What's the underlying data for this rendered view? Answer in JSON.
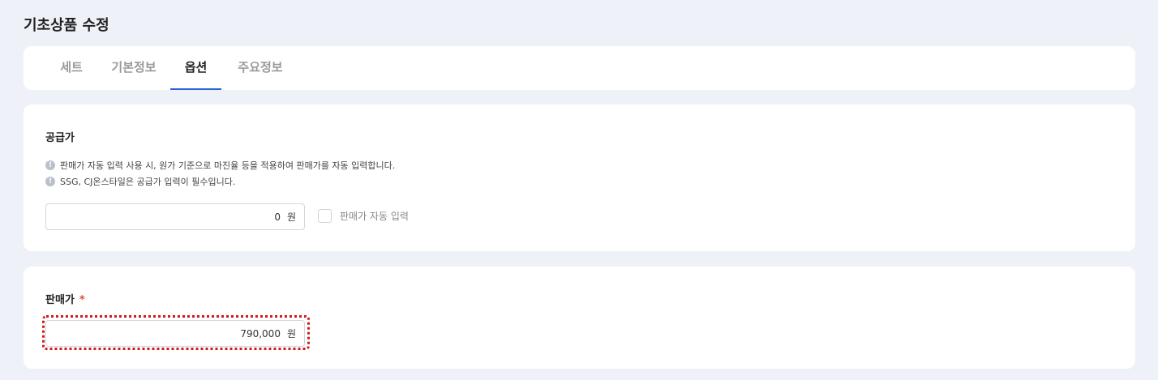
{
  "page": {
    "title": "기초상품 수정"
  },
  "tabs": [
    {
      "label": "세트",
      "active": false
    },
    {
      "label": "기본정보",
      "active": false
    },
    {
      "label": "옵션",
      "active": true
    },
    {
      "label": "주요정보",
      "active": false
    }
  ],
  "supply": {
    "label": "공급가",
    "notices": [
      "판매가 자동 입력 사용 시, 원가 기준으로 마진율 등을 적용하여 판매가를 자동 입력합니다.",
      "SSG, CJ온스타일은 공급가 입력이 필수입니다."
    ],
    "notice_icon": "info-icon",
    "value": "0",
    "unit": "원",
    "auto_input_label": "판매가 자동 입력",
    "auto_input_checked": false
  },
  "sale": {
    "label": "판매가",
    "required_mark": "*",
    "value": "790,000",
    "unit": "원"
  },
  "colors": {
    "accent": "#2a62d8",
    "required": "#e04b3a",
    "highlight": "#d11a1a",
    "background": "#eef1f8"
  }
}
